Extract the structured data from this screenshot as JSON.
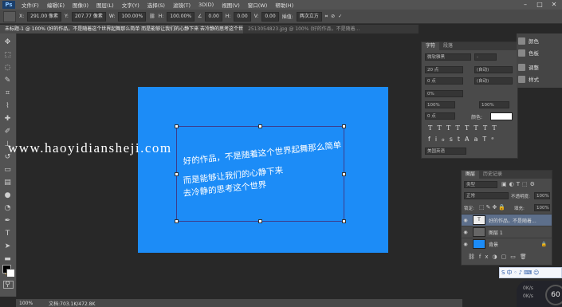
{
  "menubar": {
    "logo": "Ps",
    "items": [
      "文件(F)",
      "编辑(E)",
      "图像(I)",
      "图层(L)",
      "文字(Y)",
      "选择(S)",
      "滤镜(T)",
      "3D(D)",
      "视图(V)",
      "窗口(W)",
      "帮助(H)"
    ]
  },
  "options": {
    "x_label": "X:",
    "x_value": "291.00 像素",
    "y_label": "Y:",
    "y_value": "207.77 像素",
    "w_label": "W:",
    "w_value": "100.00%",
    "h_label": "H:",
    "h_value": "100.00%",
    "angle_value": "0.00",
    "hskew_label": "H:",
    "hskew_value": "0.00",
    "vskew_label": "V:",
    "vskew_value": "0.00",
    "interp_label": "插值:",
    "interp_value": "两次立方"
  },
  "tabs": {
    "active": "未标题-1 @ 100% (好的作品，不是随着这个世界起舞那么简单 而是能够让我们的心静下来 去冷静的思考这个世界 , RGB/8) *",
    "inactive": "2513054823.jpg @ 100% (好的作品，不是随着..."
  },
  "canvas": {
    "text_lines": [
      "好的作品，不是随着这个世界起舞那么简单",
      "而是能够让我们的心静下来",
      "去冷静的思考这个世界"
    ],
    "watermark": "www.haoyidiansheji.com"
  },
  "status": {
    "zoom": "100%",
    "doc": "文档:703.1K/472.8K"
  },
  "character_panel": {
    "tabs": [
      "字符",
      "段落"
    ],
    "font_family": "微软雅黑",
    "font_style": "-",
    "font_size": "20 点",
    "leading": "(自动)",
    "kerning": "0 点",
    "tracking": "(自动)",
    "scale_v": "0%",
    "scale_h": "100%",
    "baseline": "100%",
    "baseline_shift": "0 点",
    "color_label": "颜色:",
    "language": "美国英语"
  },
  "side_buttons": [
    "颜色",
    "色板",
    "调整",
    "样式"
  ],
  "layers": {
    "tabs": [
      "图层",
      "历史记录"
    ],
    "filter_kind": "类型",
    "blend_mode": "正常",
    "opacity_label": "不透明度:",
    "opacity": "100%",
    "lock_label": "锁定:",
    "fill_label": "填充:",
    "fill": "100%",
    "rows": [
      {
        "name": "好的作品，不是随着...",
        "thumb": "T"
      },
      {
        "name": "图层 1",
        "thumb": ""
      },
      {
        "name": "背景",
        "thumb": ""
      }
    ]
  },
  "ime": {
    "items": [
      "S",
      "中",
      "◦",
      "♪",
      "⌨",
      "☺"
    ]
  },
  "speed": {
    "value": "60",
    "up": "0K/s",
    "down": "0K/s"
  }
}
